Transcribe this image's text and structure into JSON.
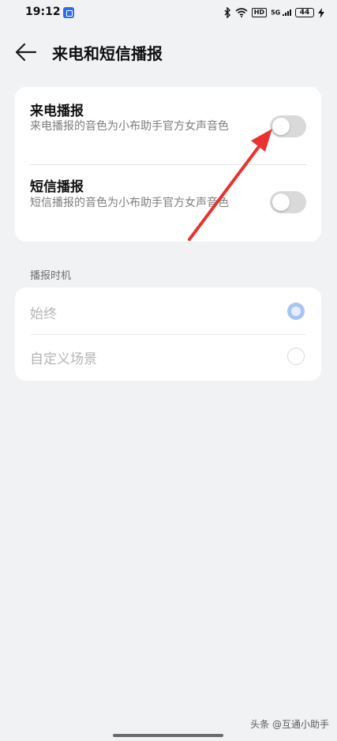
{
  "status_bar": {
    "time": "19:12",
    "hd": "HD",
    "signal": "5G",
    "battery": "44"
  },
  "header": {
    "title": "来电和短信播报"
  },
  "announce": {
    "call": {
      "title": "来电播报",
      "description": "来电播报的音色为小布助手官方女声音色",
      "enabled": false
    },
    "sms": {
      "title": "短信播报",
      "description": "短信播报的音色为小布助手官方女声音色",
      "enabled": false
    }
  },
  "timing": {
    "section_label": "播报时机",
    "options": [
      {
        "label": "始终",
        "selected": true
      },
      {
        "label": "自定义场景",
        "selected": false
      }
    ]
  },
  "watermark": "头条 @互通小助手",
  "colors": {
    "annotation_arrow": "#e8322f",
    "radio_selected": "#a8c4f2",
    "toggle_off": "#d9d9d9"
  }
}
